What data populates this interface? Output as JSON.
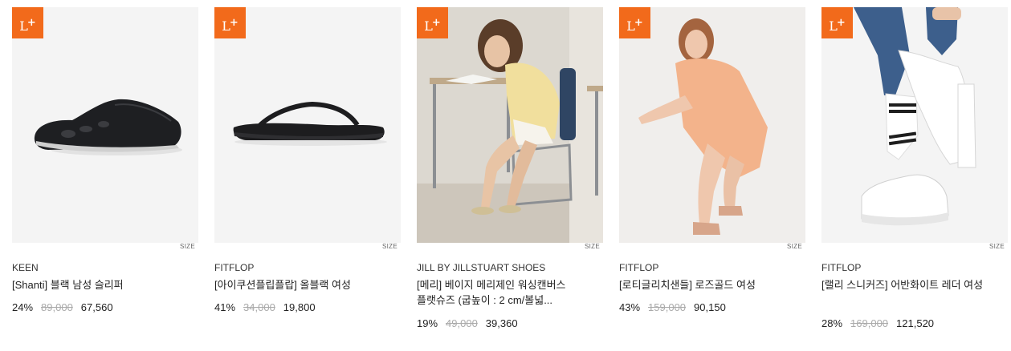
{
  "products": [
    {
      "badge": "L",
      "badge_sup": "+",
      "size_label": "SIZE",
      "brand": "KEEN",
      "name": "[Shanti] 블랙 남성 슬리퍼",
      "discount": "24%",
      "original_price": "89,000",
      "sale_price": "67,560",
      "image_icon": "black-clog-slipper-image"
    },
    {
      "badge": "L",
      "badge_sup": "+",
      "size_label": "SIZE",
      "brand": "FITFLOP",
      "name": "[아이쿠션플립플랍] 올블랙 여성",
      "discount": "41%",
      "original_price": "34,000",
      "sale_price": "19,800",
      "image_icon": "black-flip-flop-image"
    },
    {
      "badge": "L",
      "badge_sup": "+",
      "size_label": "SIZE",
      "brand": "JILL BY JILLSTUART SHOES",
      "name": "[메리] 베이지 메리제인 워싱캔버스 플랫슈즈 (굽높이 : 2 cm/볼넓...",
      "discount": "19%",
      "original_price": "49,000",
      "sale_price": "39,360",
      "image_icon": "model-seated-classroom-image"
    },
    {
      "badge": "L",
      "badge_sup": "+",
      "size_label": "SIZE",
      "brand": "FITFLOP",
      "name": "[로티글리치샌들] 로즈골드 여성",
      "discount": "43%",
      "original_price": "159,000",
      "sale_price": "90,150",
      "image_icon": "model-rose-gold-sandals-image"
    },
    {
      "badge": "L",
      "badge_sup": "+",
      "size_label": "SIZE",
      "brand": "FITFLOP",
      "name": "[랠리 스니커즈] 어반화이트 레더 여성",
      "discount": "28%",
      "original_price": "169,000",
      "sale_price": "121,520",
      "image_icon": "white-leather-sneakers-image"
    }
  ]
}
